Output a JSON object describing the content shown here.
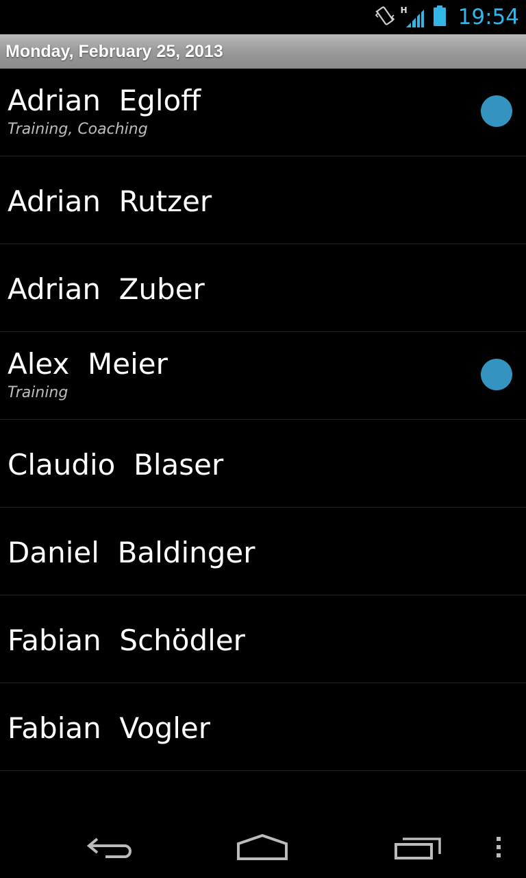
{
  "status_bar": {
    "time": "19:54",
    "network_type": "H",
    "icons": [
      "vibrate-icon",
      "signal-icon",
      "battery-icon"
    ]
  },
  "header": {
    "date": "Monday, February 25, 2013"
  },
  "people": [
    {
      "name": "Adrian  Egloff",
      "subtitle": "Training, Coaching",
      "has_dot": true
    },
    {
      "name": "Adrian  Rutzer",
      "subtitle": "",
      "has_dot": false
    },
    {
      "name": "Adrian  Zuber",
      "subtitle": "",
      "has_dot": false
    },
    {
      "name": "Alex  Meier",
      "subtitle": "Training",
      "has_dot": true
    },
    {
      "name": "Claudio  Blaser",
      "subtitle": "",
      "has_dot": false
    },
    {
      "name": "Daniel  Baldinger",
      "subtitle": "",
      "has_dot": false
    },
    {
      "name": "Fabian  Schödler",
      "subtitle": "",
      "has_dot": false
    },
    {
      "name": "Fabian  Vogler",
      "subtitle": "",
      "has_dot": false
    }
  ],
  "colors": {
    "accent": "#33b5e5",
    "dot": "#3593bf",
    "divider": "#262626"
  },
  "nav": {
    "icons": [
      "back-icon",
      "home-icon",
      "recent-apps-icon",
      "overflow-menu-icon"
    ]
  }
}
